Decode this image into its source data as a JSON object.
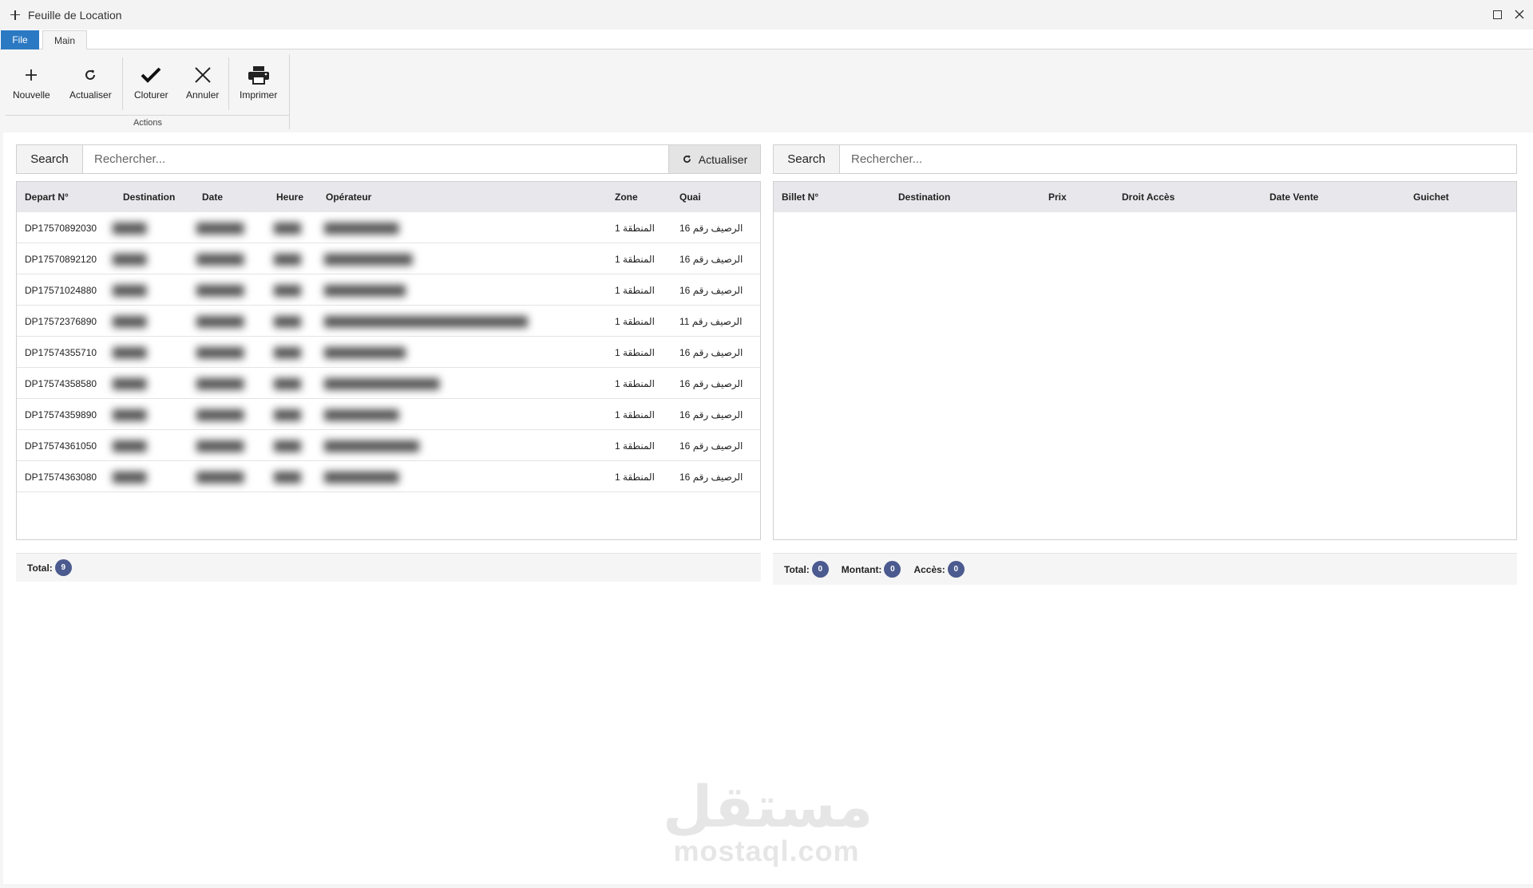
{
  "window": {
    "title": "Feuille de Location",
    "icon": "plus-icon"
  },
  "ribbon": {
    "tabs": {
      "file": "File",
      "main": "Main"
    },
    "group_label": "Actions",
    "buttons": {
      "nouvelle": "Nouvelle",
      "actualiser": "Actualiser",
      "cloturer": "Cloturer",
      "annuler": "Annuler",
      "imprimer": "Imprimer"
    }
  },
  "left": {
    "search_label": "Search",
    "search_placeholder": "Rechercher...",
    "refresh_label": "Actualiser",
    "columns": [
      "Depart N°",
      "Destination",
      "Date",
      "Heure",
      "Opérateur",
      "Zone",
      "Quai"
    ],
    "rows": [
      {
        "depart": "DP17570892030",
        "destination": "█████",
        "date": "███████",
        "heure": "████",
        "operateur": "███████████",
        "zone": "المنطقة 1",
        "quai": "الرصيف رقم 16"
      },
      {
        "depart": "DP17570892120",
        "destination": "█████",
        "date": "███████",
        "heure": "████",
        "operateur": "█████████████",
        "zone": "المنطقة 1",
        "quai": "الرصيف رقم 16"
      },
      {
        "depart": "DP17571024880",
        "destination": "█████",
        "date": "███████",
        "heure": "████",
        "operateur": "████████████",
        "zone": "المنطقة 1",
        "quai": "الرصيف رقم 16"
      },
      {
        "depart": "DP17572376890",
        "destination": "█████",
        "date": "███████",
        "heure": "████",
        "operateur": "██████████████████████████████",
        "zone": "المنطقة 1",
        "quai": "الرصيف رقم 11"
      },
      {
        "depart": "DP17574355710",
        "destination": "█████",
        "date": "███████",
        "heure": "████",
        "operateur": "████████████",
        "zone": "المنطقة 1",
        "quai": "الرصيف رقم 16"
      },
      {
        "depart": "DP17574358580",
        "destination": "█████",
        "date": "███████",
        "heure": "████",
        "operateur": "█████████████████",
        "zone": "المنطقة 1",
        "quai": "الرصيف رقم 16"
      },
      {
        "depart": "DP17574359890",
        "destination": "█████",
        "date": "███████",
        "heure": "████",
        "operateur": "███████████",
        "zone": "المنطقة 1",
        "quai": "الرصيف رقم 16"
      },
      {
        "depart": "DP17574361050",
        "destination": "█████",
        "date": "███████",
        "heure": "████",
        "operateur": "██████████████",
        "zone": "المنطقة 1",
        "quai": "الرصيف رقم 16"
      },
      {
        "depart": "DP17574363080",
        "destination": "█████",
        "date": "███████",
        "heure": "████",
        "operateur": "███████████",
        "zone": "المنطقة 1",
        "quai": "الرصيف رقم 16"
      }
    ],
    "footer": {
      "total_label": "Total:",
      "total_value": "9"
    }
  },
  "right": {
    "search_label": "Search",
    "search_placeholder": "Rechercher...",
    "columns": [
      "Billet N°",
      "Destination",
      "Prix",
      "Droit Accès",
      "Date Vente",
      "Guichet"
    ],
    "footer": {
      "total_label": "Total:",
      "total_value": "0",
      "montant_label": "Montant:",
      "montant_value": "0",
      "acces_label": "Accès:",
      "acces_value": "0"
    }
  },
  "watermark": {
    "arabic": "مستقل",
    "latin": "mostaql.com"
  },
  "colors": {
    "accent": "#2b79c3",
    "badge": "#4b5a8f",
    "header_bg": "#e8e8ec"
  }
}
